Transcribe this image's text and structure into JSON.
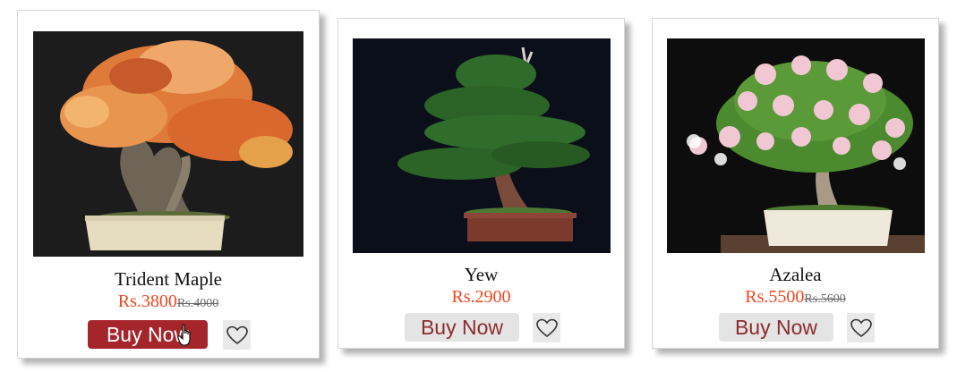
{
  "products": [
    {
      "name": "Trident Maple",
      "price": "Rs.3800",
      "old_price": "Rs.4000",
      "button": "Buy Now",
      "state": "hover"
    },
    {
      "name": "Yew",
      "price": "Rs.2900",
      "old_price": "",
      "button": "Buy Now",
      "state": "normal"
    },
    {
      "name": "Azalea",
      "price": "Rs.5500",
      "old_price": "Rs.5600",
      "button": "Buy Now",
      "state": "normal"
    }
  ],
  "icons": {
    "wishlist": "heart-outline-icon",
    "cursor": "hand-pointer-cursor"
  },
  "colors": {
    "price": "#f0461e",
    "button_hover": "#a4262b",
    "button_text": "#8b2b2f",
    "button_bg": "#e4e4e4"
  }
}
